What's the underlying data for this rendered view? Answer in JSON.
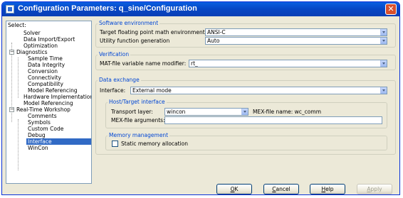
{
  "window": {
    "title": "Configuration Parameters: q_sine/Configuration",
    "close_glyph": "✕"
  },
  "tree": {
    "header": "Select:",
    "items": [
      {
        "label": "Solver"
      },
      {
        "label": "Data Import/Export"
      },
      {
        "label": "Optimization"
      },
      {
        "label": "Diagnostics",
        "expander": "−"
      },
      {
        "label": "Sample Time"
      },
      {
        "label": "Data Integrity"
      },
      {
        "label": "Conversion"
      },
      {
        "label": "Connectivity"
      },
      {
        "label": "Compatibility"
      },
      {
        "label": "Model Referencing"
      },
      {
        "label": "Hardware Implementation"
      },
      {
        "label": "Model Referencing"
      },
      {
        "label": "Real-Time Workshop",
        "expander": "−"
      },
      {
        "label": "Comments"
      },
      {
        "label": "Symbols"
      },
      {
        "label": "Custom Code"
      },
      {
        "label": "Debug"
      },
      {
        "label": "Interface",
        "selected": true
      },
      {
        "label": "WinCon"
      }
    ]
  },
  "software_env": {
    "title": "Software environment",
    "math_label": "Target floating point math environment:",
    "math_value": "ANSI-C",
    "utility_label": "Utility function generation",
    "utility_value": "Auto"
  },
  "verification": {
    "title": "Verification",
    "mat_label": "MAT-file variable name modifier:",
    "mat_value": "rt_"
  },
  "data_exchange": {
    "title": "Data exchange",
    "interface_label": "Interface:",
    "interface_value": "External mode",
    "host_target": {
      "title": "Host/Target interface",
      "transport_label": "Transport layer:",
      "transport_value": "wincon",
      "mex_name_text": "MEX-file name: wc_comm",
      "mex_args_label": "MEX-file arguments:",
      "mex_args_value": ""
    },
    "memory": {
      "title": "Memory management",
      "static_label": "Static memory allocation",
      "static_checked": false
    }
  },
  "buttons": {
    "ok_m": "O",
    "ok_rest": "K",
    "cancel_m": "C",
    "cancel_rest": "ancel",
    "help_m": "H",
    "help_rest": "elp",
    "apply_m": "A",
    "apply_rest": "pply"
  }
}
